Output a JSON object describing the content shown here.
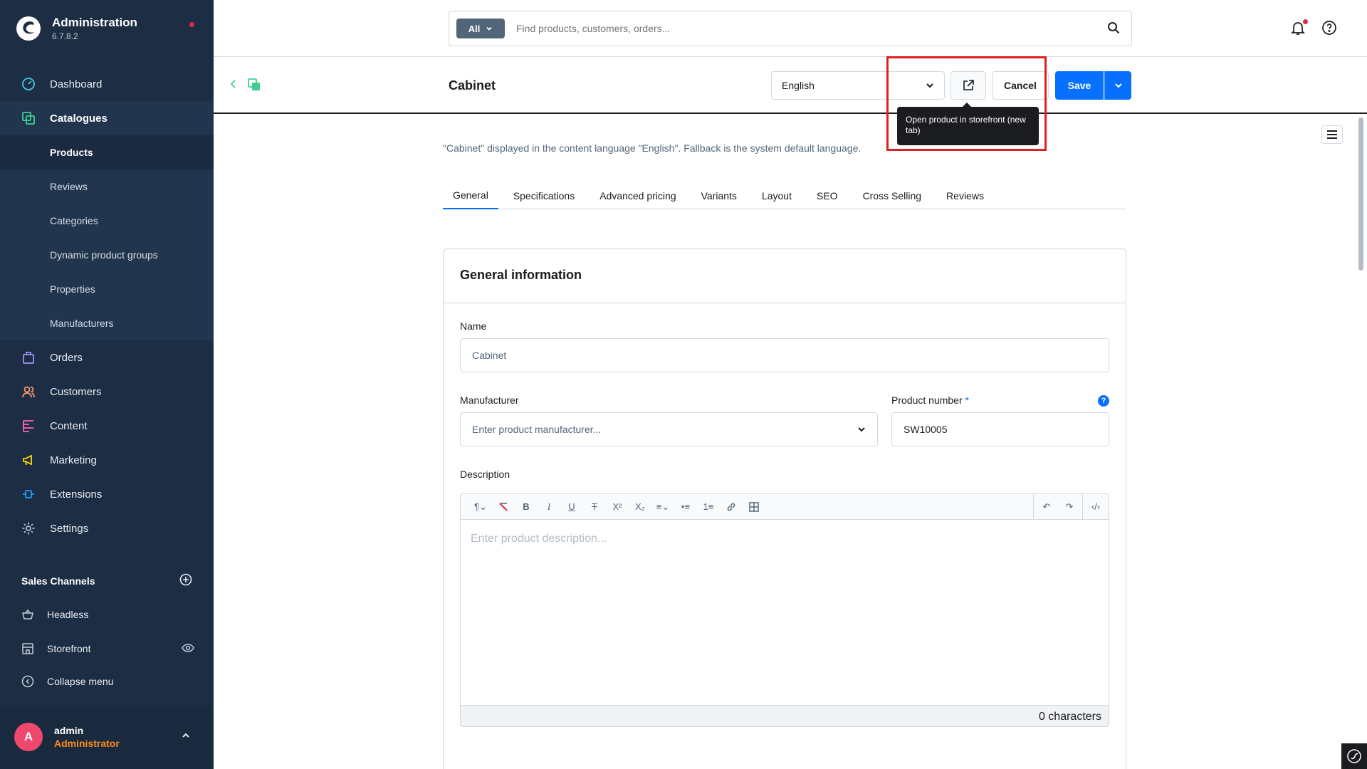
{
  "brand": {
    "title": "Administration",
    "version": "6.7.8.2"
  },
  "nav": {
    "dashboard": "Dashboard",
    "catalogues": "Catalogues",
    "catalogue_items": [
      "Products",
      "Reviews",
      "Categories",
      "Dynamic product groups",
      "Properties",
      "Manufacturers"
    ],
    "orders": "Orders",
    "customers": "Customers",
    "content": "Content",
    "marketing": "Marketing",
    "extensions": "Extensions",
    "settings": "Settings"
  },
  "sales_channels": {
    "header": "Sales Channels",
    "items": [
      "Headless",
      "Storefront"
    ],
    "collapse": "Collapse menu"
  },
  "user": {
    "initial": "A",
    "name": "admin",
    "role": "Administrator"
  },
  "search": {
    "type": "All",
    "placeholder": "Find products, customers, orders..."
  },
  "smartbar": {
    "title": "Cabinet",
    "language": "English",
    "cancel": "Cancel",
    "save": "Save",
    "tooltip": "Open product in storefront (new tab)"
  },
  "lang_info": "\"Cabinet\" displayed in the content language \"English\". Fallback is the system default language.",
  "tabs": [
    "General",
    "Specifications",
    "Advanced pricing",
    "Variants",
    "Layout",
    "SEO",
    "Cross Selling",
    "Reviews"
  ],
  "general_card": {
    "title": "General information",
    "name_label": "Name",
    "name_value": "Cabinet",
    "manufacturer_label": "Manufacturer",
    "manufacturer_placeholder": "Enter product manufacturer...",
    "product_number_label": "Product number",
    "product_number_required": "*",
    "product_number_value": "SW10005",
    "help_glyph": "?",
    "description_label": "Description",
    "description_placeholder": "Enter product description...",
    "char_count": "0 characters"
  },
  "colors": {
    "sidebar": "#1c2d44",
    "accent": "#0870ff",
    "highlight": "#e02020"
  }
}
